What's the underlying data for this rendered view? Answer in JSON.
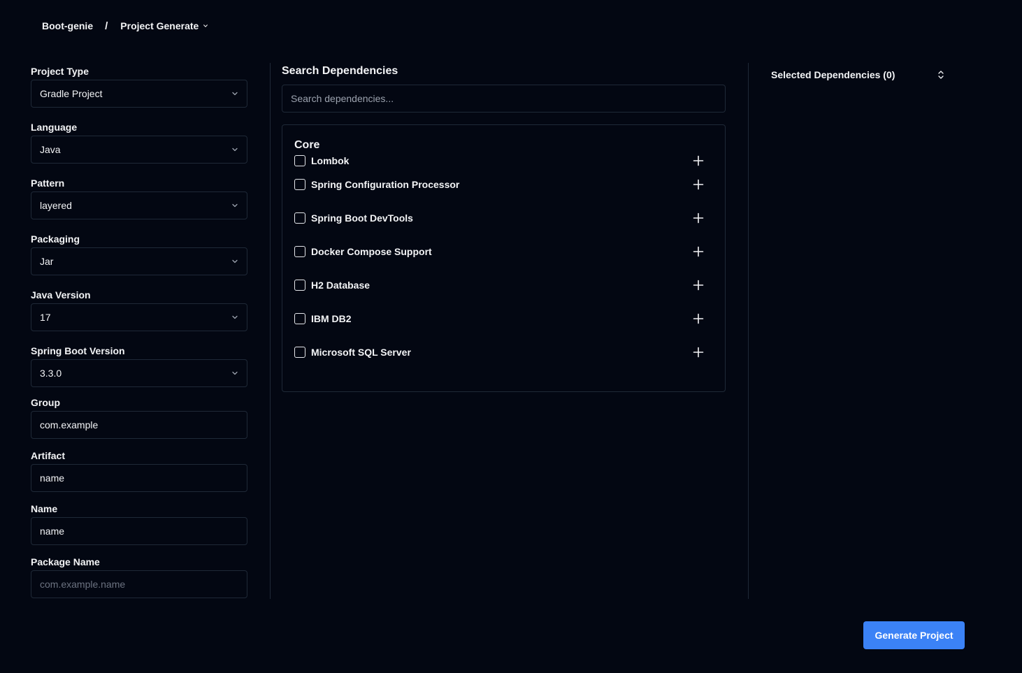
{
  "breadcrumb": {
    "root": "Boot-genie",
    "separator": "/",
    "current": "Project Generate"
  },
  "form": {
    "project_type": {
      "label": "Project Type",
      "value": "Gradle Project"
    },
    "language": {
      "label": "Language",
      "value": "Java"
    },
    "pattern": {
      "label": "Pattern",
      "value": "layered"
    },
    "packaging": {
      "label": "Packaging",
      "value": "Jar"
    },
    "java_version": {
      "label": "Java Version",
      "value": "17"
    },
    "spring_boot_version": {
      "label": "Spring Boot Version",
      "value": "3.3.0"
    },
    "group": {
      "label": "Group",
      "value": "com.example"
    },
    "artifact": {
      "label": "Artifact",
      "value": "name"
    },
    "name": {
      "label": "Name",
      "value": "name"
    },
    "package_name": {
      "label": "Package Name",
      "placeholder": "com.example.name"
    }
  },
  "search": {
    "title": "Search Dependencies",
    "placeholder": "Search dependencies..."
  },
  "dependencies": {
    "group_title": "Core",
    "items": [
      "Lombok",
      "Spring Configuration Processor",
      "Spring Boot DevTools",
      "Docker Compose Support",
      "H2 Database",
      "IBM DB2",
      "Microsoft SQL Server"
    ]
  },
  "selected": {
    "title": "Selected Dependencies (0)"
  },
  "actions": {
    "generate_label": "Generate Project"
  },
  "colors": {
    "background": "#030712",
    "border": "#1f2937",
    "primary": "#3b82f6"
  }
}
